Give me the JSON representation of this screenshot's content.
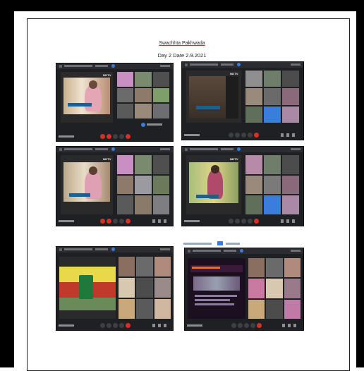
{
  "document": {
    "title": "Swachhta Pakhwada",
    "subtitle": "Day 2 Date 2.9.2021"
  },
  "screenshots": [
    {
      "channel_logo": "NDTV"
    },
    {
      "channel_logo": "NDTV"
    },
    {
      "channel_logo": "NDTV"
    },
    {
      "channel_logo": "NDTV"
    },
    {
      "channel_logo": ""
    },
    {
      "channel_logo": ""
    }
  ]
}
